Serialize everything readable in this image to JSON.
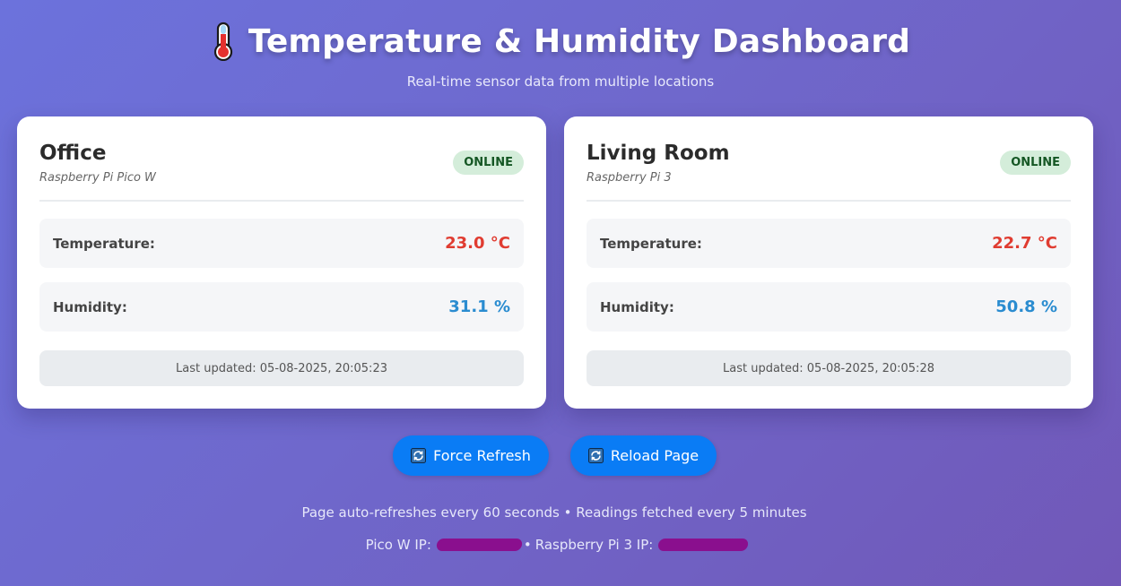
{
  "header": {
    "title": "Temperature & Humidity Dashboard",
    "subtitle": "Real-time sensor data from multiple locations",
    "icon": "thermometer-icon"
  },
  "sensors": [
    {
      "name": "Office",
      "device": "Raspberry Pi Pico W",
      "status": "ONLINE",
      "temperature_label": "Temperature:",
      "temperature_value": "23.0 °C",
      "humidity_label": "Humidity:",
      "humidity_value": "31.1 %",
      "last_updated": "Last updated: 05-08-2025, 20:05:23"
    },
    {
      "name": "Living Room",
      "device": "Raspberry Pi 3",
      "status": "ONLINE",
      "temperature_label": "Temperature:",
      "temperature_value": "22.7 °C",
      "humidity_label": "Humidity:",
      "humidity_value": "50.8 %",
      "last_updated": "Last updated: 05-08-2025, 20:05:28"
    }
  ],
  "buttons": {
    "force_refresh": "Force Refresh",
    "reload_page": "Reload Page",
    "icon": "refresh-icon"
  },
  "footer": {
    "refresh_info": "Page auto-refreshes every 60 seconds • Readings fetched every 5 minutes",
    "pico_ip_label": "Pico W IP:",
    "separator": "•",
    "pi3_ip_label": "Raspberry Pi 3 IP:"
  },
  "colors": {
    "background_start": "#6c72dc",
    "background_end": "#7158b8",
    "online_badge_bg": "#d4edda",
    "online_badge_text": "#155724",
    "temperature": "#e03c31",
    "humidity": "#2a8cd0",
    "button": "#0a7cf5",
    "redaction": "#8a0f8e"
  }
}
